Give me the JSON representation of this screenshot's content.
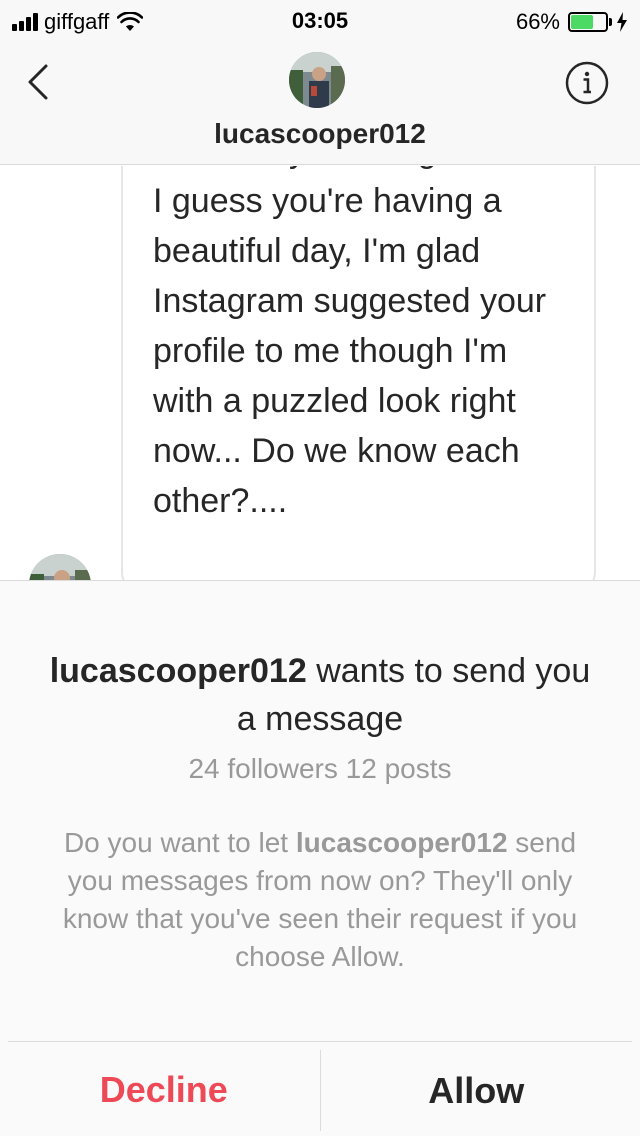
{
  "status_bar": {
    "carrier": "giffgaff",
    "time": "03:05",
    "battery_percent": "66%",
    "battery_level": 0.66,
    "battery_color": "#4cd964"
  },
  "header": {
    "username": "lucascooper012",
    "back_icon": "chevron-left-icon",
    "info_icon": "info-icon"
  },
  "message": {
    "text": "How are you doing Girl?.... I guess you're having a beautiful day, I'm glad Instagram suggested your profile to me though I'm with a puzzled look right now... Do we know each other?...."
  },
  "request": {
    "username": "lucascooper012",
    "title_rest": " wants to send you a message",
    "stats": "24 followers 12 posts",
    "body_prefix": "Do you want to let ",
    "body_username": "lucascooper012",
    "body_suffix": " send you messages from now on? They'll only know that you've seen their request if you choose Allow.",
    "decline_label": "Decline",
    "allow_label": "Allow",
    "decline_color": "#ed4956"
  }
}
